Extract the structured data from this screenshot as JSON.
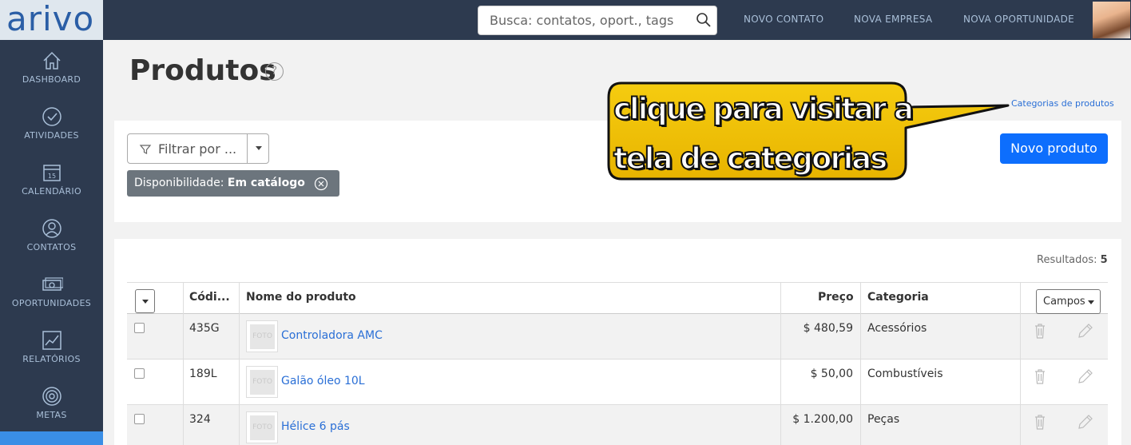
{
  "app": {
    "logo": "arivo"
  },
  "header": {
    "search_placeholder": "Busca: contatos, oport., tags",
    "links": [
      "NOVO CONTATO",
      "NOVA EMPRESA",
      "NOVA OPORTUNIDADE"
    ]
  },
  "sidebar": {
    "items": [
      {
        "label": "DASHBOARD",
        "icon": "home-icon"
      },
      {
        "label": "ATIVIDADES",
        "icon": "check-circle-icon"
      },
      {
        "label": "CALENDÁRIO",
        "icon": "calendar-icon",
        "day": "15"
      },
      {
        "label": "CONTATOS",
        "icon": "user-icon"
      },
      {
        "label": "OPORTUNIDADES",
        "icon": "money-icon"
      },
      {
        "label": "RELATÓRIOS",
        "icon": "chart-icon"
      },
      {
        "label": "METAS",
        "icon": "target-icon"
      }
    ]
  },
  "page": {
    "title": "Produtos",
    "help": "?",
    "categories_link": "Categorias de produtos",
    "filter_label": "Filtrar por ...",
    "active_filter": {
      "key": "Disponibilidade:",
      "value": "Em catálogo"
    },
    "new_product_label": "Novo produto",
    "results_label": "Resultados:",
    "results_count": "5"
  },
  "table": {
    "columns": {
      "code": "Códi...",
      "name": "Nome do produto",
      "price": "Preço",
      "category": "Categoria"
    },
    "fields_button": "Campos",
    "photo_placeholder": "FOTO",
    "rows": [
      {
        "code": "435G",
        "name": "Controladora AMC",
        "price": "$ 480,59",
        "category": "Acessórios"
      },
      {
        "code": "189L",
        "name": "Galão óleo 10L",
        "price": "$ 50,00",
        "category": "Combustíveis"
      },
      {
        "code": "324",
        "name": "Hélice 6 pás",
        "price": "$ 1.200,00",
        "category": "Peças"
      }
    ]
  },
  "callout": {
    "line1": "clique para visitar a",
    "line2": "tela de categorias"
  },
  "colors": {
    "navbar": "#2d3a4f",
    "primary": "#0d6efd",
    "link": "#2a6fd6",
    "callout_fill": "#f2c200"
  }
}
